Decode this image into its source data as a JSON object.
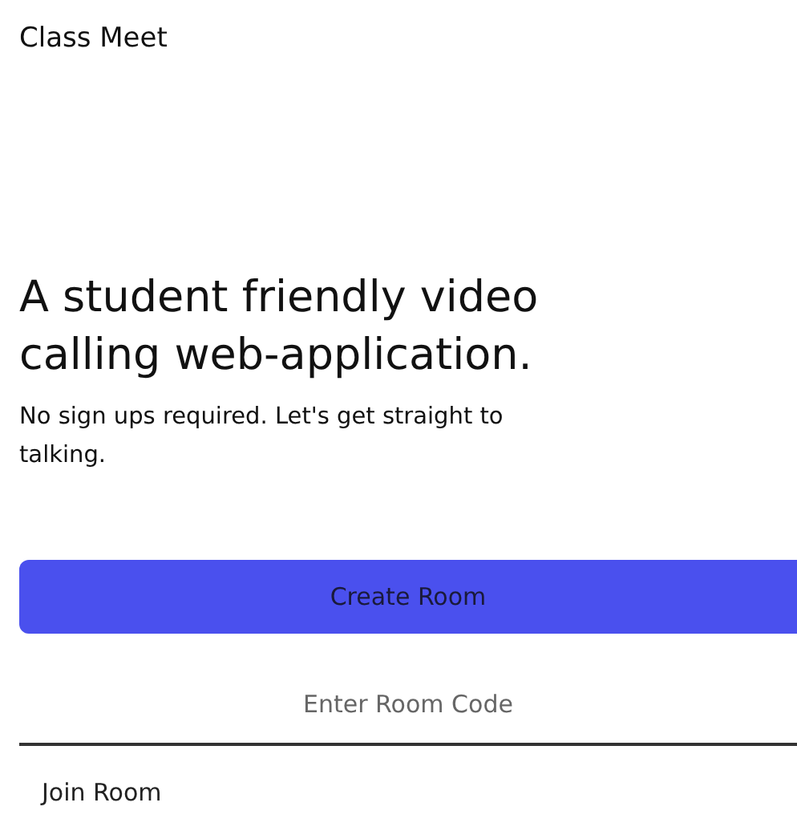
{
  "brand": "Class Meet",
  "hero": {
    "title": "A student friendly video calling web-application.",
    "subtitle": "No sign ups required. Let's get straight to talking."
  },
  "create_button": "Create Room",
  "room_code": {
    "placeholder": "Enter Room Code"
  },
  "join_button": "Join Room"
}
